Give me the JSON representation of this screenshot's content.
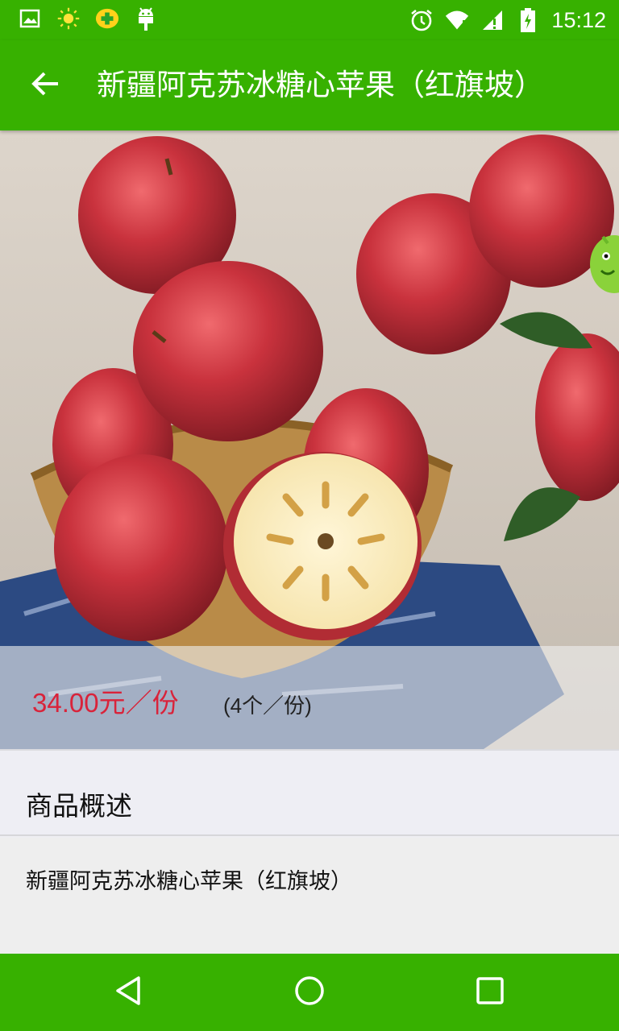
{
  "status_bar": {
    "time": "15:12",
    "icons": [
      "image-icon",
      "sun-icon",
      "plus-badge-icon",
      "android-icon",
      "alarm-icon",
      "wifi-icon",
      "signal-icon",
      "battery-icon"
    ]
  },
  "app_bar": {
    "title": "新疆阿克苏冰糖心苹果（红旗坡）",
    "back_icon": "arrow-left-icon"
  },
  "product": {
    "image": "apple-photo",
    "price": "34.00元／份",
    "unit": "(4个／份)"
  },
  "overview": {
    "heading": "商品概述",
    "text": "新疆阿克苏冰糖心苹果（红旗坡）"
  },
  "nav_bar": {
    "buttons": [
      "back-triangle-icon",
      "home-circle-icon",
      "recents-square-icon"
    ]
  },
  "colors": {
    "primary": "#37b100",
    "price": "#d9233a",
    "background": "#eeeef2"
  }
}
